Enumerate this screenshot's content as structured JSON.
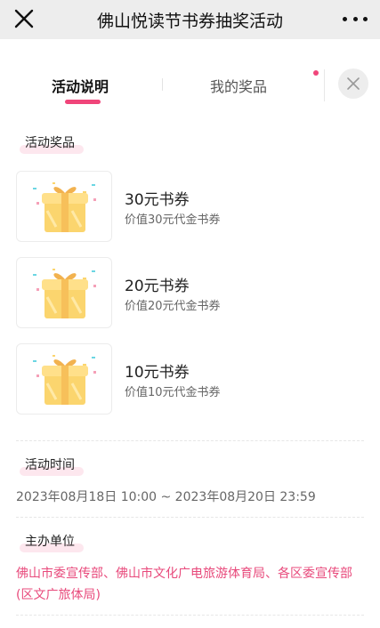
{
  "header": {
    "title": "佛山悦读节书券抽奖活动"
  },
  "tabs": [
    {
      "label": "活动说明",
      "active": true
    },
    {
      "label": "我的奖品",
      "active": false,
      "has_badge": true
    }
  ],
  "sections": {
    "prizes_title": "活动奖品",
    "prizes": [
      {
        "name": "30元书券",
        "desc": "价值30元代金书券"
      },
      {
        "name": "20元书券",
        "desc": "价值20元代金书券"
      },
      {
        "name": "10元书券",
        "desc": "价值10元代金书券"
      }
    ],
    "time_title": "活动时间",
    "time_value": "2023年08月18日 10:00 ~ 2023年08月20日 23:59",
    "org_title": "主办单位",
    "org_value": "佛山市委宣传部、佛山市文化广电旅游体育局、各区委宣传部 (区文广旅体局)"
  },
  "colors": {
    "accent": "#f0457a",
    "org_text": "#e8497b",
    "label_highlight": "#fde7ee"
  },
  "icons": {
    "close": "close-icon",
    "more": "more-icon",
    "panel_close": "panel-close-icon",
    "gift": "gift-box-icon"
  }
}
